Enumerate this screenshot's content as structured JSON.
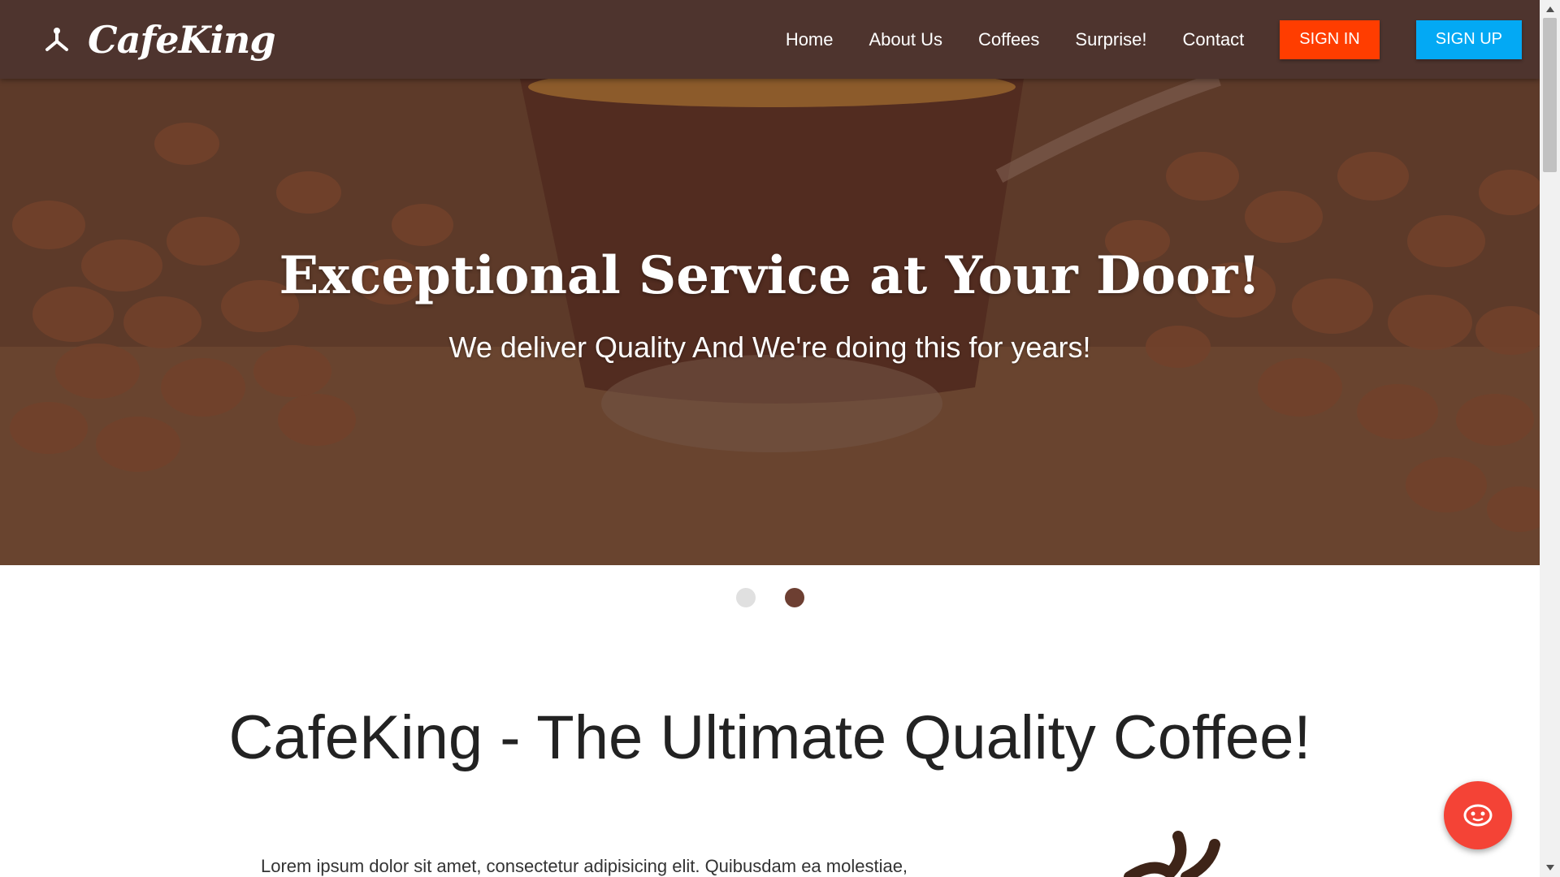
{
  "brand": {
    "name": "CafeKing",
    "icon": "coffee-tree-icon"
  },
  "nav": {
    "links": [
      "Home",
      "About Us",
      "Coffees",
      "Surprise!",
      "Contact"
    ],
    "signin_label": "SIGN IN",
    "signup_label": "SIGN UP"
  },
  "hero": {
    "title": "Exceptional Service at Your Door!",
    "subtitle": "We deliver Quality And We're doing this for years!",
    "active_slide": 2,
    "slide_count": 2
  },
  "section": {
    "title": "CafeKing - The Ultimate Quality Coffee!",
    "paragraph": "Lorem ipsum dolor sit amet, consectetur adipisicing elit. Quibusdam ea molestiae,"
  },
  "fab": {
    "icon": "chat-face-icon"
  },
  "colors": {
    "navbar": "#4e342e",
    "signin": "#ff3d00",
    "signup": "#03a9f4",
    "fab": "#f44336",
    "dot_active": "#6d3f32",
    "dot_inactive": "#e0e0e0"
  }
}
